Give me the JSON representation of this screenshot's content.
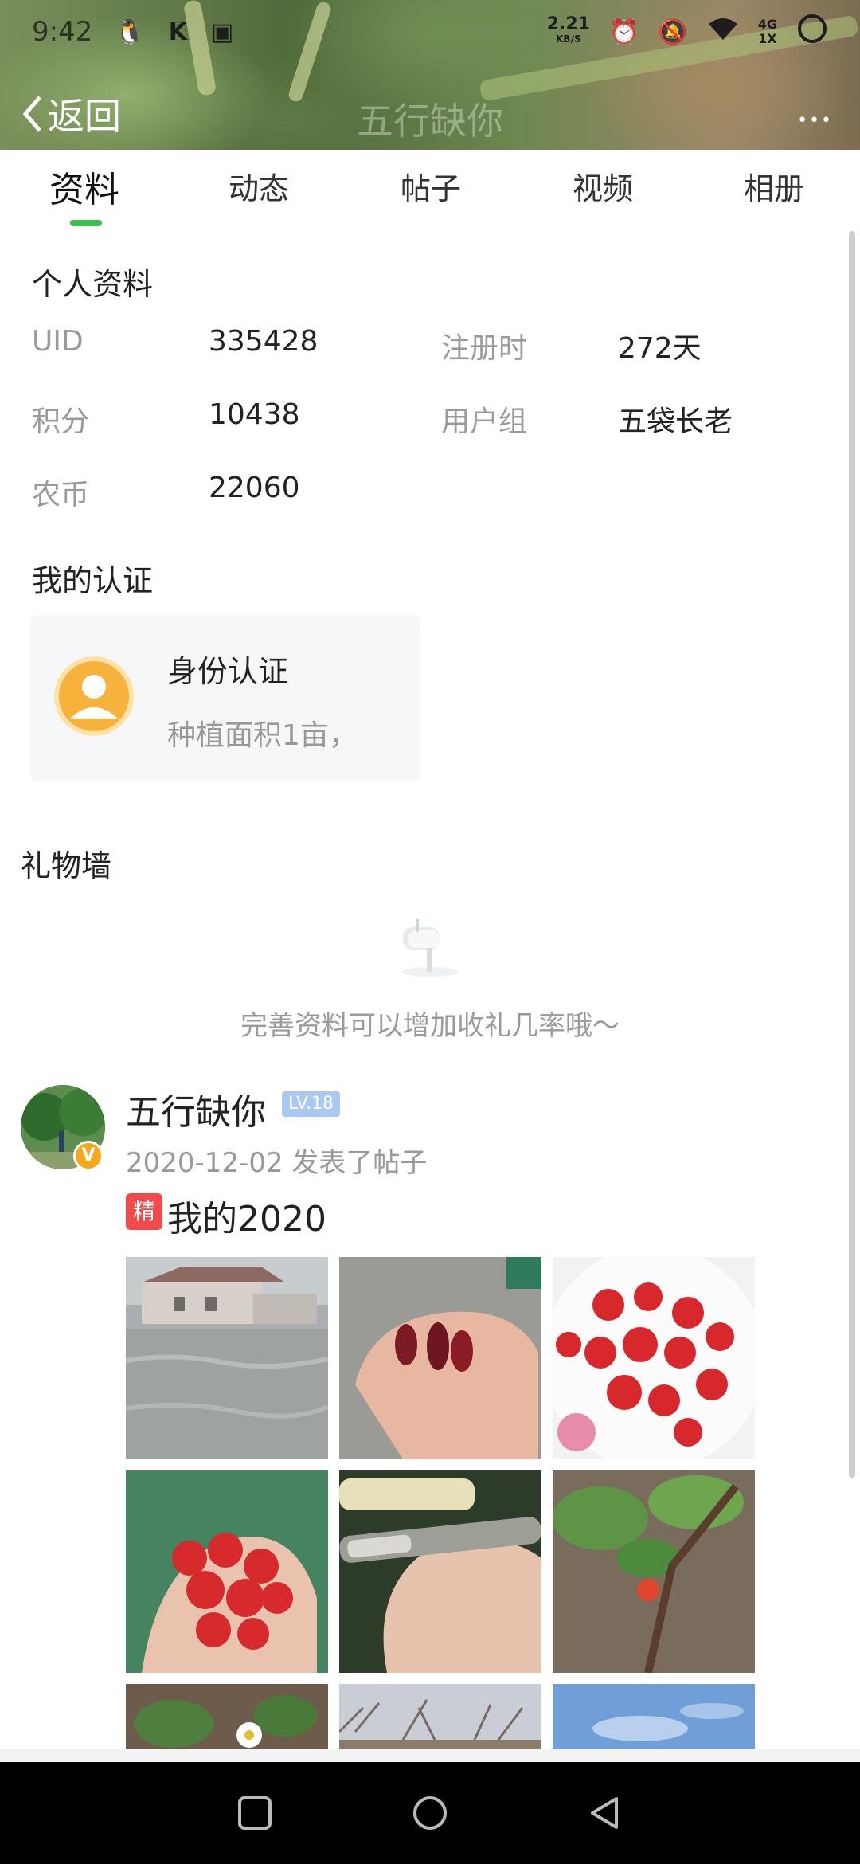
{
  "status_bar": {
    "time": "9:42",
    "net_speed_value": "2.21",
    "net_speed_unit": "KB/S",
    "network_label": "4G",
    "network_sub": "1X"
  },
  "header": {
    "back_label": "返回",
    "title": "五行缺你",
    "more_label": "•••"
  },
  "tabs": [
    {
      "label": "资料",
      "active": true
    },
    {
      "label": "动态",
      "active": false
    },
    {
      "label": "帖子",
      "active": false
    },
    {
      "label": "视频",
      "active": false
    },
    {
      "label": "相册",
      "active": false
    }
  ],
  "profile": {
    "section_title": "个人资料",
    "uid_label": "UID",
    "uid_value": "335428",
    "register_label": "注册时",
    "register_value": "272天",
    "points_label": "积分",
    "points_value": "10438",
    "group_label": "用户组",
    "group_value": "五袋长老",
    "coins_label": "农币",
    "coins_value": "22060"
  },
  "certification": {
    "section_title": "我的认证",
    "card_title": "身份认证",
    "card_desc": "种植面积1亩，"
  },
  "gift_wall": {
    "section_title": "礼物墙",
    "hint": "完善资料可以增加收礼几率哦～"
  },
  "post": {
    "author": "五行缺你",
    "level": "LV.18",
    "verify_mark": "V",
    "meta": "2020-12-02  发表了帖子",
    "featured_badge": "精",
    "title": "我的2020",
    "images": [
      "house-flood-photo",
      "mulberries-in-hand-photo",
      "strawberries-on-plate-photo",
      "strawberries-in-hand-photo",
      "grafting-branch-photo",
      "raspberry-plant-photo",
      "strawberry-flower-photo",
      "bare-trees-photo",
      "blue-sky-photo"
    ]
  },
  "colors": {
    "accent_green": "#3bbf4f",
    "badge_red": "#ef4b4b",
    "level_blue": "#a9c9f2",
    "verify_orange": "#f3a91b"
  }
}
